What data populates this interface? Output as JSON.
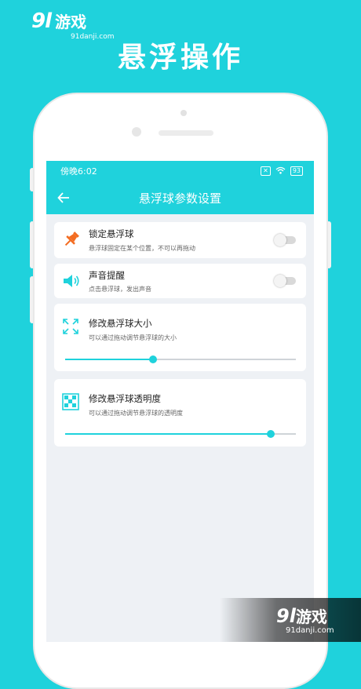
{
  "watermark": {
    "logo": "9l",
    "name": "游戏",
    "site": "91danji.com"
  },
  "hero_title": "悬浮操作",
  "status_bar": {
    "time": "傍晚6:02",
    "battery": "93"
  },
  "app_bar": {
    "title": "悬浮球参数设置"
  },
  "settings": {
    "lock": {
      "title": "锁定悬浮球",
      "desc": "悬浮球固定在某个位置，不可以再拖动",
      "enabled": false
    },
    "sound": {
      "title": "声音提醒",
      "desc": "点击悬浮球，发出声音",
      "enabled": false
    },
    "size": {
      "title": "修改悬浮球大小",
      "desc": "可以通过拖动调节悬浮球的大小",
      "value": 0.38
    },
    "opacity": {
      "title": "修改悬浮球透明度",
      "desc": "可以通过拖动调节悬浮球的透明度",
      "value": 0.89
    }
  },
  "colors": {
    "accent": "#1fd2dc",
    "pin": "#f36c21"
  }
}
